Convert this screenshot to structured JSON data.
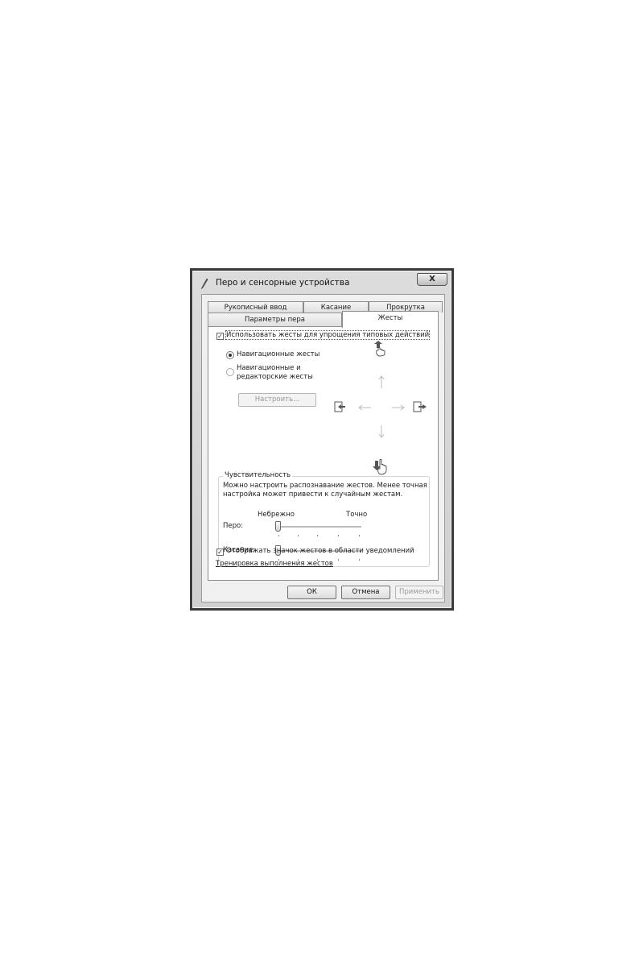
{
  "window": {
    "title": "Перо и сенсорные устройства",
    "close_glyph": "X"
  },
  "tabs": {
    "row1": [
      "Рукописный ввод",
      "Касание",
      "Прокрутка"
    ],
    "row2": [
      "Параметры пера",
      "Жесты"
    ],
    "active": "Жесты"
  },
  "gestures": {
    "use_gestures_label": "Использовать жесты для упрощения типовых действий",
    "use_gestures_checked": true,
    "mode_nav_label": "Навигационные жесты",
    "mode_edit_label_line1": "Навигационные и",
    "mode_edit_label_line2": "редакторские жесты",
    "selected_mode": "Навигационные жесты",
    "customize_button": "Настроить..."
  },
  "sensitivity": {
    "legend": "Чувствительность",
    "desc_line1": "Можно настроить распознавание жестов. Менее точная",
    "desc_line2": "настройка может привести к случайным жестам.",
    "min_label": "Небрежно",
    "max_label": "Точно",
    "pen_label": "Перо:",
    "touch_label": "Касание:",
    "pen_level": 0,
    "touch_level": 0
  },
  "footer": {
    "show_icon_label": "Отображать значок жестов в области уведомлений",
    "show_icon_checked": true,
    "training_link": "Тренировка выполнения жестов",
    "ok": "ОК",
    "cancel": "Отмена",
    "apply": "Применить"
  },
  "icons": [
    "pen-icon",
    "hand-flick-up-icon",
    "hand-flick-down-icon",
    "page-back-icon",
    "page-forward-icon"
  ],
  "colors": {
    "frame": "#3a3a3a",
    "panel": "#ffffff",
    "client": "#f0f0f0",
    "border": "#8d8d8d"
  }
}
